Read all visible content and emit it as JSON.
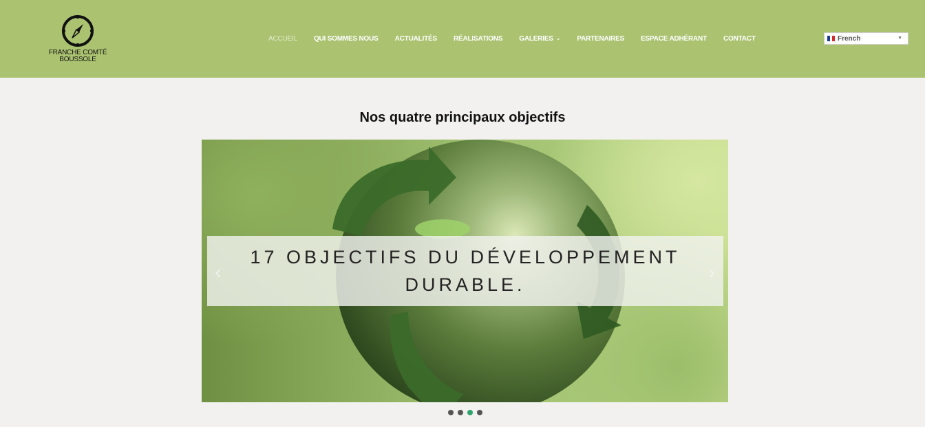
{
  "logo": {
    "line1": "FRANCHE COMTÉ",
    "line2": "BOUSSOLE",
    "icon": "compass-icon"
  },
  "nav": {
    "items": [
      {
        "label": "ACCUEIL",
        "active": true
      },
      {
        "label": "QUI SOMMES NOUS"
      },
      {
        "label": "ACTUALITÉS"
      },
      {
        "label": "RÉALISATIONS"
      },
      {
        "label": "GALERIES",
        "has_dropdown": true
      },
      {
        "label": "PARTENAIRES"
      },
      {
        "label": "ESPACE ADHÉRANT"
      },
      {
        "label": "CONTACT"
      }
    ]
  },
  "language": {
    "selected": "French",
    "flag": "french-flag-icon"
  },
  "main": {
    "title": "Nos quatre principaux objectifs",
    "slider": {
      "caption": "17 OBJECTIFS DU DÉVELOPPEMENT DURABLE.",
      "prev_icon": "chevron-left-icon",
      "next_icon": "chevron-right-icon",
      "dot_count": 4,
      "active_dot": 3
    }
  },
  "colors": {
    "header_bg": "#abc371",
    "page_bg": "#f2f1ef",
    "active_dot": "#2ea36e"
  }
}
